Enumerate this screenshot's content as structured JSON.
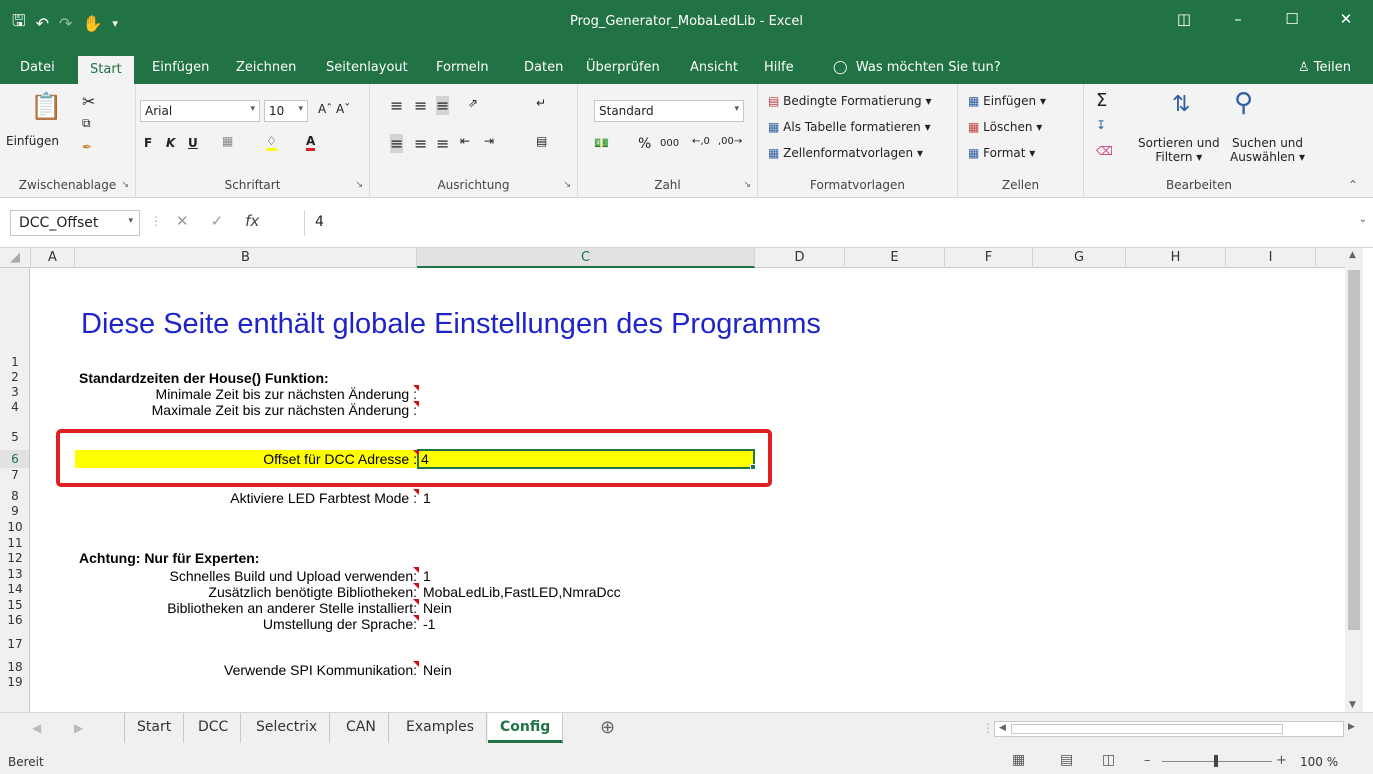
{
  "window": {
    "title": "Prog_Generator_MobaLedLib - Excel"
  },
  "menu": {
    "tabs": [
      "Datei",
      "Start",
      "Einfügen",
      "Zeichnen",
      "Seitenlayout",
      "Formeln",
      "Daten",
      "Überprüfen",
      "Ansicht",
      "Hilfe"
    ],
    "active_tab": "Start",
    "tell_me": "Was möchten Sie tun?",
    "share": "Teilen"
  },
  "ribbon": {
    "clipboard": {
      "paste": "Einfügen",
      "label": "Zwischenablage"
    },
    "font": {
      "name": "Arial",
      "size": "10",
      "bold": "F",
      "italic": "K",
      "underline": "U",
      "label": "Schriftart"
    },
    "alignment": {
      "label": "Ausrichtung"
    },
    "number": {
      "format": "Standard",
      "percent": "%",
      "thousands": "000",
      "label": "Zahl"
    },
    "styles": {
      "conditional": "Bedingte Formatierung",
      "as_table": "Als Tabelle formatieren",
      "cell_styles": "Zellenformatvorlagen",
      "label": "Formatvorlagen"
    },
    "cells": {
      "insert": "Einfügen",
      "delete": "Löschen",
      "format": "Format",
      "label": "Zellen"
    },
    "editing": {
      "sort1": "Sortieren und",
      "sort2": "Filtern",
      "find1": "Suchen und",
      "find2": "Auswählen",
      "label": "Bearbeiten"
    }
  },
  "formula_bar": {
    "name_box": "DCC_Offset",
    "fx": "fx",
    "value": "4"
  },
  "grid": {
    "columns": [
      "A",
      "B",
      "C",
      "D",
      "E",
      "F",
      "G",
      "H",
      "I"
    ],
    "selected_column": "C",
    "rows": [
      "1",
      "2",
      "3",
      "4",
      "5",
      "6",
      "7",
      "8",
      "9",
      "10",
      "11",
      "12",
      "13",
      "14",
      "15",
      "16",
      "17",
      "18",
      "19"
    ],
    "selected_row": "6"
  },
  "sheet": {
    "heading": "Diese Seite enthält globale Einstellungen des Programms",
    "section1": "Standardzeiten der House() Funktion:",
    "min_time_label": "Minimale Zeit bis zur nächsten Änderung :",
    "max_time_label": "Maximale Zeit bis zur nächsten Änderung :",
    "dcc_offset_label": "Offset für DCC Adresse :",
    "dcc_offset_value": "4",
    "led_test_label": "Aktiviere LED Farbtest Mode :",
    "led_test_value": "1",
    "section2": "Achtung: Nur für Experten:",
    "fast_build_label": "Schnelles Build und Upload verwenden:",
    "fast_build_value": "1",
    "libs_label": "Zusätzlich benötigte Bibliotheken:",
    "libs_value": "MobaLedLib,FastLED,NmraDcc",
    "libs_other_label": "Bibliotheken an anderer Stelle installiert:",
    "libs_other_value": "Nein",
    "language_label": "Umstellung der Sprache:",
    "language_value": "-1",
    "spi_label": "Verwende SPI Kommunikation:",
    "spi_value": "Nein",
    "highlight_color": "#ffff00",
    "callout_color": "#e02020"
  },
  "sheet_tabs": {
    "tabs": [
      "Start",
      "DCC",
      "Selectrix",
      "CAN",
      "Examples",
      "Config"
    ],
    "active": "Config"
  },
  "status": {
    "ready": "Bereit",
    "zoom": "100 %"
  }
}
